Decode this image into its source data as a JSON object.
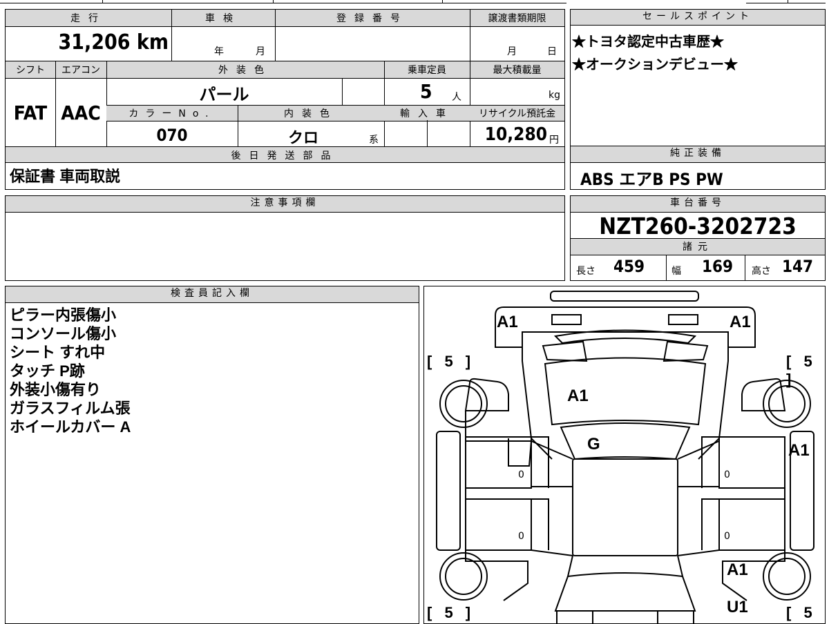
{
  "top_left": {
    "headers": {
      "mileage": "走行",
      "inspection": "車検",
      "registration": "登録番号",
      "transfer_deadline": "譲渡書類期限",
      "shift": "シフト",
      "aircon": "エアコン",
      "exterior_color": "外装色",
      "capacity": "乗車定員",
      "max_load": "最大積載量",
      "color_no": "カラーNo.",
      "interior_color": "内装色",
      "import": "輸入車",
      "recycle_fee": "リサイクル預託金",
      "later_parts": "後日発送部品"
    },
    "values": {
      "mileage": "31,206 km",
      "inspection_year": "年",
      "inspection_month": "月",
      "transfer_month": "月",
      "transfer_day": "日",
      "shift": "FAT",
      "aircon": "AAC",
      "exterior_color": "パール",
      "capacity": "5",
      "capacity_unit": "人",
      "max_load_unit": "kg",
      "color_no": "070",
      "interior_color": "クロ",
      "interior_suffix": "系",
      "recycle_fee": "10,280",
      "recycle_unit": "円",
      "later_parts": "保証書 車両取説"
    }
  },
  "sales_points": {
    "header": "セールスポイント",
    "lines": [
      "★トヨタ認定中古車歴★",
      "★オークションデビュー★"
    ]
  },
  "genuine_equipment": {
    "header": "純正装備",
    "value": "ABS エアB PS PW"
  },
  "notes": {
    "header": "注意事項欄"
  },
  "chassis": {
    "header": "車台番号",
    "value": "NZT260-3202723",
    "spec_header": "諸元",
    "length_label": "長さ",
    "length": "459",
    "width_label": "幅",
    "width": "169",
    "height_label": "高さ",
    "height": "147"
  },
  "inspector": {
    "header": "検査員記入欄",
    "lines": [
      "ピラー内張傷小",
      "コンソール傷小",
      "シート すれ中",
      "タッチ P跡",
      "外装小傷有り",
      "ガラスフィルム張",
      "ホイールカバー A"
    ]
  },
  "diagram": {
    "marks": {
      "front_left": "A1",
      "front_right": "A1",
      "hood": "A1",
      "windshield": "G",
      "right_side": "A1",
      "rear_right": "A1",
      "rear_bottom": "U1",
      "door_fl": "0",
      "door_rl": "0",
      "door_fr": "0",
      "door_rr": "0"
    },
    "tires": {
      "front_left": "[ 5 ]",
      "front_right": "[ 5 ]",
      "rear_left": "[ 5 ]",
      "rear_right": "[ 5 ]"
    }
  }
}
